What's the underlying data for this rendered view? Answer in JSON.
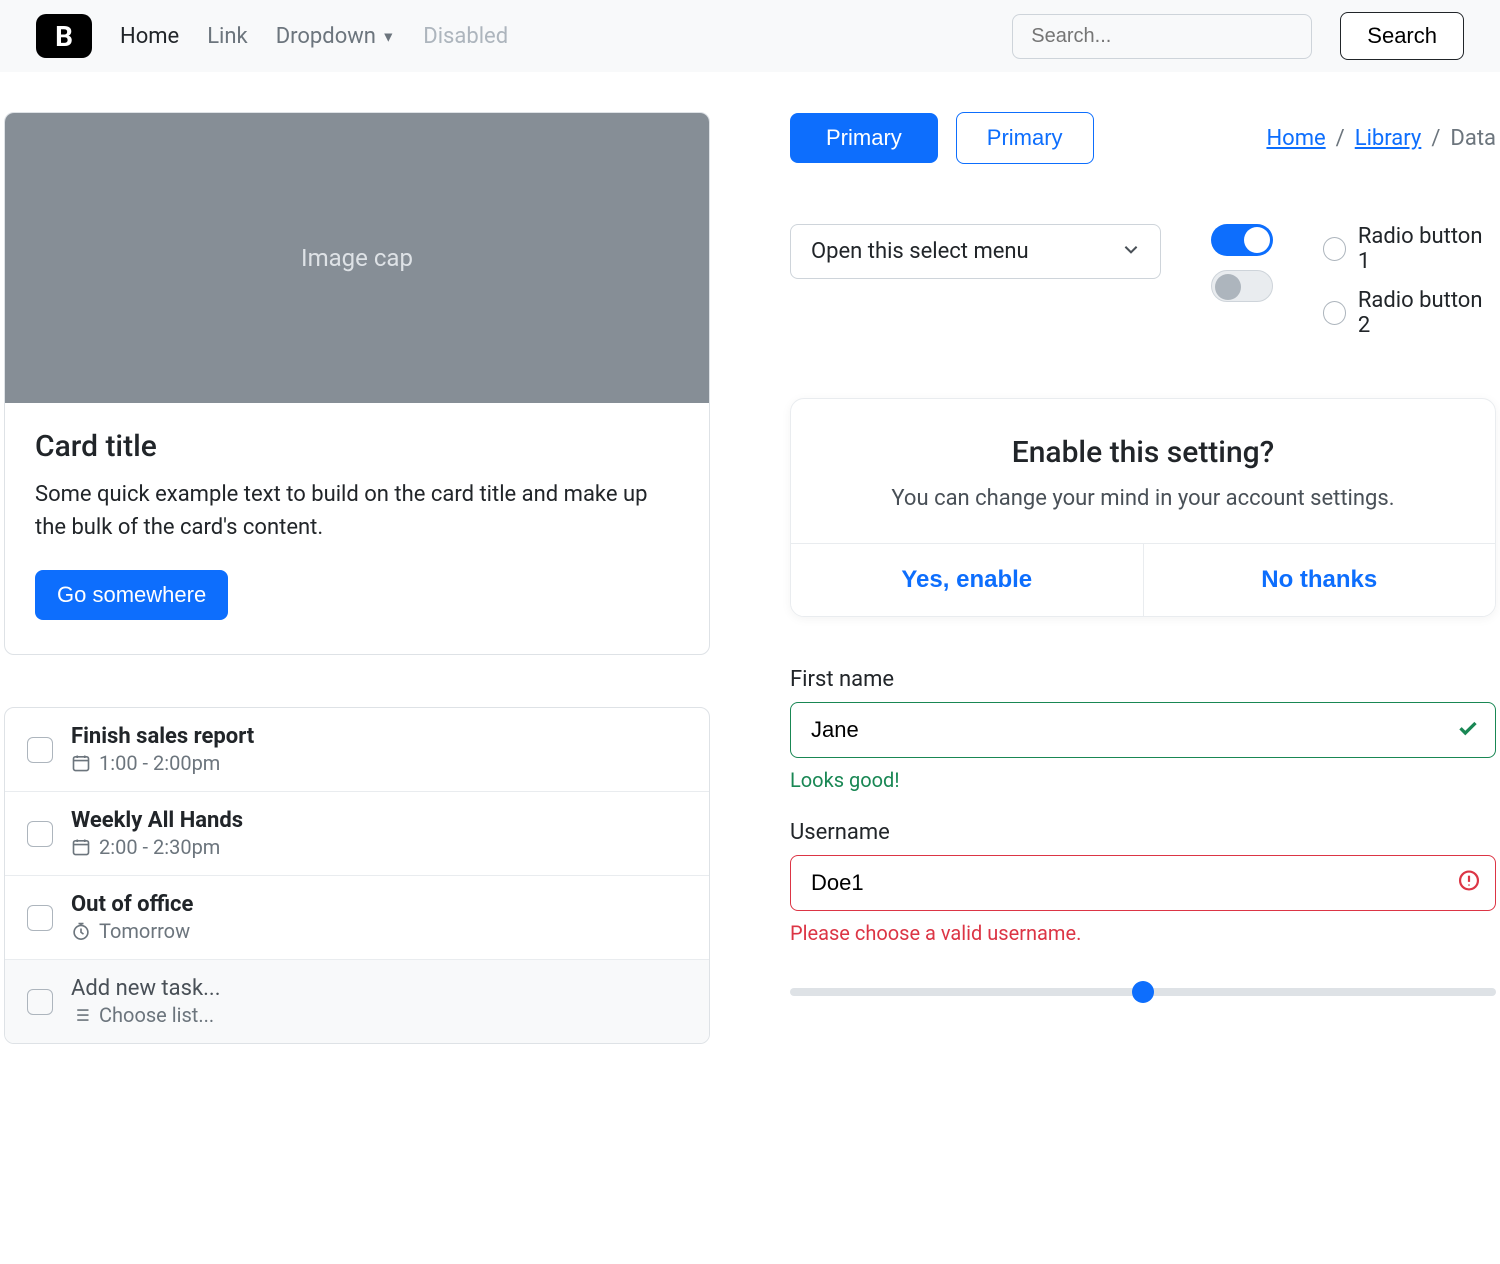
{
  "nav": {
    "items": [
      "Home",
      "Link",
      "Dropdown",
      "Disabled"
    ],
    "search_placeholder": "Search...",
    "search_button": "Search"
  },
  "card": {
    "image_label": "Image cap",
    "title": "Card title",
    "text": "Some quick example text to build on the card title and make up the bulk of the card's content.",
    "button": "Go somewhere"
  },
  "tasks": [
    {
      "title": "Finish sales report",
      "meta": "1:00 - 2:00pm",
      "icon": "calendar"
    },
    {
      "title": "Weekly All Hands",
      "meta": "2:00 - 2:30pm",
      "icon": "calendar"
    },
    {
      "title": "Out of office",
      "meta": "Tomorrow",
      "icon": "clock"
    },
    {
      "title": "Add new task...",
      "meta": "Choose list...",
      "icon": "list",
      "add": true
    }
  ],
  "buttons": {
    "primary_fill": "Primary",
    "primary_outline": "Primary"
  },
  "breadcrumb": {
    "items": [
      "Home",
      "Library",
      "Data"
    ]
  },
  "select": {
    "label": "Open this select menu"
  },
  "toggles": [
    {
      "on": true
    },
    {
      "on": false
    }
  ],
  "radios": [
    "Radio button 1",
    "Radio button 2"
  ],
  "dialog": {
    "title": "Enable this setting?",
    "text": "You can change your mind in your account settings.",
    "yes": "Yes, enable",
    "no": "No thanks"
  },
  "form": {
    "first_name": {
      "label": "First name",
      "value": "Jane",
      "feedback": "Looks good!"
    },
    "username": {
      "label": "Username",
      "value": "Doe1",
      "feedback": "Please choose a valid username."
    }
  },
  "slider": {
    "value": 50
  },
  "colors": {
    "primary": "#0d6efd",
    "success": "#198754",
    "danger": "#dc3545"
  }
}
